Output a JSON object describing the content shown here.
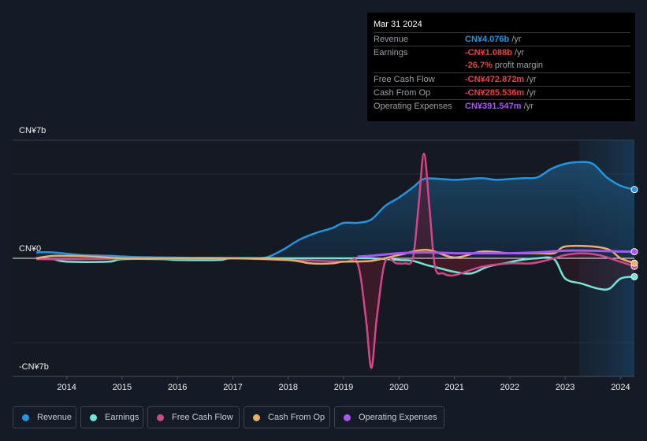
{
  "tooltip": {
    "date": "Mar 31 2024",
    "rows": [
      {
        "label": "Revenue",
        "value": "CN¥4.076b",
        "suffix": " /yr",
        "color": "#2394df"
      },
      {
        "label": "Earnings",
        "value": "-CN¥1.088b",
        "suffix": " /yr",
        "color": "#e64141"
      },
      {
        "label": "",
        "value": "-26.7%",
        "suffix": " profit margin",
        "color": "#e64141"
      },
      {
        "label": "Free Cash Flow",
        "value": "-CN¥472.872m",
        "suffix": " /yr",
        "color": "#e64141"
      },
      {
        "label": "Cash From Op",
        "value": "-CN¥285.536m",
        "suffix": " /yr",
        "color": "#e64141"
      },
      {
        "label": "Operating Expenses",
        "value": "CN¥391.547m",
        "suffix": " /yr",
        "color": "#a855f7"
      }
    ]
  },
  "legend": [
    {
      "label": "Revenue",
      "color": "#2394df"
    },
    {
      "label": "Earnings",
      "color": "#6ee7d6"
    },
    {
      "label": "Free Cash Flow",
      "color": "#d2478b"
    },
    {
      "label": "Cash From Op",
      "color": "#e8b060"
    },
    {
      "label": "Operating Expenses",
      "color": "#a855f7"
    }
  ],
  "chart_data": {
    "type": "line",
    "title": "",
    "xlabel": "",
    "ylabel": "",
    "y_tick_labels": [
      "CN¥7b",
      "CN¥0",
      "-CN¥7b"
    ],
    "ylim": [
      -7,
      7
    ],
    "y_unit": "CN¥ billions",
    "xlim": [
      2013.45,
      2024.25
    ],
    "x_tick_labels": [
      "2014",
      "2015",
      "2016",
      "2017",
      "2018",
      "2019",
      "2020",
      "2021",
      "2022",
      "2023",
      "2024"
    ],
    "x_ticks": [
      2014,
      2015,
      2016,
      2017,
      2018,
      2019,
      2020,
      2021,
      2022,
      2023,
      2024
    ],
    "highlight_from": 2023.25,
    "gridlines": [
      5,
      -5
    ],
    "series": [
      {
        "name": "Revenue",
        "color": "#2394df",
        "x": [
          2013.45,
          2013.75,
          2014.25,
          2014.75,
          2015.25,
          2015.75,
          2016.25,
          2016.75,
          2017.25,
          2017.6,
          2017.9,
          2018.2,
          2018.5,
          2018.8,
          2019.0,
          2019.25,
          2019.5,
          2019.75,
          2020.0,
          2020.25,
          2020.45,
          2020.75,
          2021.0,
          2021.25,
          2021.5,
          2021.75,
          2022.0,
          2022.25,
          2022.5,
          2022.75,
          2023.0,
          2023.25,
          2023.5,
          2023.75,
          2024.0,
          2024.25
        ],
        "y": [
          0.35,
          0.35,
          0.2,
          0.15,
          0.08,
          0.05,
          0.03,
          0.03,
          0.02,
          0.05,
          0.5,
          1.1,
          1.5,
          1.8,
          2.1,
          2.1,
          2.3,
          3.1,
          3.6,
          4.2,
          4.7,
          4.7,
          4.65,
          4.7,
          4.75,
          4.65,
          4.7,
          4.75,
          4.8,
          5.3,
          5.6,
          5.7,
          5.6,
          4.8,
          4.3,
          4.076
        ]
      },
      {
        "name": "Earnings",
        "color": "#6ee7d6",
        "x": [
          2013.45,
          2013.75,
          2014.0,
          2014.75,
          2015.0,
          2015.75,
          2016.0,
          2016.75,
          2017.0,
          2018.0,
          2019.0,
          2019.5,
          2020.0,
          2020.25,
          2020.5,
          2020.75,
          2021.0,
          2021.3,
          2021.6,
          2021.9,
          2022.2,
          2022.5,
          2022.8,
          2023.0,
          2023.3,
          2023.6,
          2023.8,
          2024.0,
          2024.25
        ],
        "y": [
          0.0,
          -0.05,
          -0.2,
          -0.2,
          -0.05,
          -0.05,
          -0.1,
          -0.1,
          0.0,
          0.0,
          0.0,
          0.0,
          -0.1,
          -0.15,
          -0.4,
          -0.6,
          -0.8,
          -0.9,
          -0.5,
          -0.3,
          -0.1,
          0.0,
          -0.05,
          -1.2,
          -1.5,
          -1.8,
          -1.8,
          -1.2,
          -1.088
        ]
      },
      {
        "name": "Free Cash Flow",
        "color": "#d2478b",
        "x": [
          2013.45,
          2014.0,
          2015.0,
          2016.0,
          2017.0,
          2018.0,
          2019.0,
          2019.25,
          2019.4,
          2019.5,
          2019.6,
          2019.75,
          2019.95,
          2020.1,
          2020.25,
          2020.35,
          2020.45,
          2020.55,
          2020.65,
          2020.8,
          2021.0,
          2021.5,
          2022.0,
          2022.4,
          2022.8,
          2023.0,
          2023.3,
          2023.6,
          2023.9,
          2024.25
        ],
        "y": [
          -0.05,
          -0.05,
          -0.02,
          -0.02,
          0.0,
          -0.1,
          -0.2,
          -0.3,
          -3.5,
          -6.5,
          -3.5,
          -0.2,
          -0.3,
          -0.3,
          0.0,
          3.0,
          6.2,
          3.0,
          -0.5,
          -0.9,
          -1.0,
          -0.5,
          -0.3,
          -0.3,
          0.0,
          0.2,
          0.3,
          0.2,
          -0.1,
          -0.473
        ]
      },
      {
        "name": "Cash From Op",
        "color": "#e8b060",
        "x": [
          2013.45,
          2013.8,
          2014.5,
          2015.0,
          2016.0,
          2017.0,
          2018.0,
          2018.4,
          2018.8,
          2019.0,
          2019.5,
          2020.0,
          2020.5,
          2021.0,
          2021.5,
          2022.0,
          2022.5,
          2022.8,
          2023.0,
          2023.5,
          2023.8,
          2024.0,
          2024.25
        ],
        "y": [
          0.0,
          0.15,
          0.1,
          0.0,
          0.0,
          0.0,
          -0.1,
          -0.3,
          -0.3,
          -0.2,
          -0.15,
          0.2,
          0.5,
          0.05,
          0.4,
          0.3,
          0.3,
          0.3,
          0.7,
          0.7,
          0.5,
          0.0,
          -0.286
        ]
      },
      {
        "name": "Operating Expenses",
        "color": "#a855f7",
        "x": [
          2019.25,
          2019.5,
          2020.0,
          2020.5,
          2021.0,
          2021.5,
          2022.0,
          2022.5,
          2023.0,
          2023.5,
          2024.0,
          2024.25
        ],
        "y": [
          0.1,
          0.15,
          0.3,
          0.35,
          0.3,
          0.3,
          0.3,
          0.35,
          0.45,
          0.45,
          0.4,
          0.392
        ]
      }
    ]
  }
}
